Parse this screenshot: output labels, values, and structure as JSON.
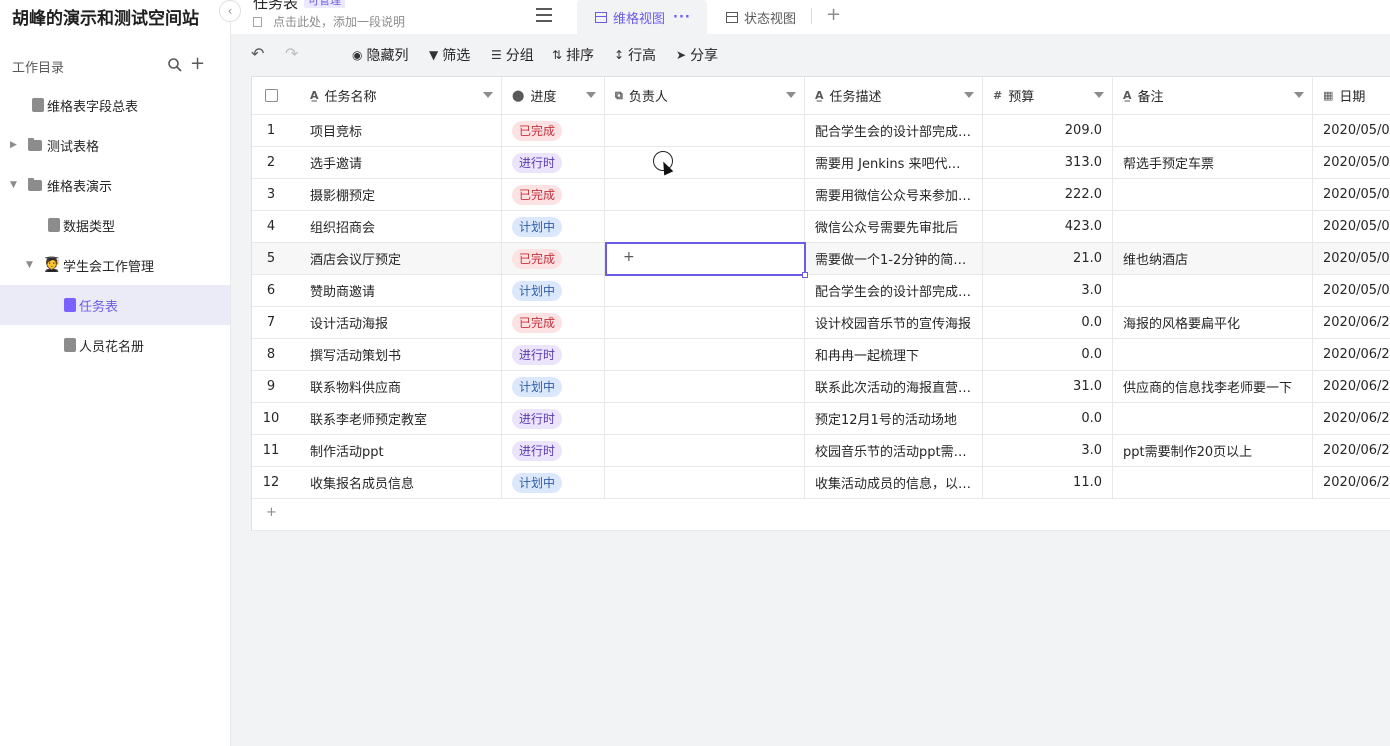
{
  "sidebar": {
    "space_title": "胡峰的演示和测试空间站",
    "directory_label": "工作目录",
    "items": [
      {
        "label": "维格表字段总表",
        "type": "doc",
        "level": 1,
        "active": false
      },
      {
        "label": "测试表格",
        "type": "folder",
        "level": 0,
        "expanded": false,
        "active": false
      },
      {
        "label": "维格表演示",
        "type": "folder",
        "level": 0,
        "expanded": true,
        "active": false
      },
      {
        "label": "数据类型",
        "type": "doc",
        "level": 2,
        "active": false
      },
      {
        "label": "学生会工作管理",
        "type": "emoji-folder",
        "emoji": "🧑‍🎓",
        "level": 1,
        "expanded": true,
        "active": false
      },
      {
        "label": "任务表",
        "type": "doc",
        "level": 3,
        "active": true
      },
      {
        "label": "人员花名册",
        "type": "doc",
        "level": 3,
        "active": false
      }
    ]
  },
  "header": {
    "table_title": "任务表",
    "permission_badge": "可管理",
    "description_placeholder": "点击此处，添加一段说明",
    "tabs": [
      {
        "label": "维格视图",
        "active": true,
        "more": "···"
      },
      {
        "label": "状态视图",
        "active": false
      }
    ],
    "add_view": "+"
  },
  "toolbar": {
    "undo": "↶",
    "redo": "↷",
    "hide_columns": "隐藏列",
    "filter": "筛选",
    "group": "分组",
    "sort": "排序",
    "row_height": "行高",
    "share": "分享"
  },
  "grid": {
    "columns": {
      "name": "任务名称",
      "progress": "进度",
      "owner": "负责人",
      "desc": "任务描述",
      "budget": "预算",
      "note": "备注",
      "date": "日期"
    },
    "rows": [
      {
        "idx": "1",
        "name": "项目竞标",
        "progress": "已完成",
        "status": "done",
        "desc": "配合学生会的设计部完成…",
        "budget": "209.0",
        "note": "",
        "date": "2020/05/0"
      },
      {
        "idx": "2",
        "name": "选手邀请",
        "progress": "进行时",
        "status": "doing",
        "desc": "需要用 Jenkins 来吧代码…",
        "budget": "313.0",
        "note": "帮选手预定车票",
        "date": "2020/05/0"
      },
      {
        "idx": "3",
        "name": "摄影棚预定",
        "progress": "已完成",
        "status": "done",
        "desc": "需要用微信公众号来参加…",
        "budget": "222.0",
        "note": "",
        "date": "2020/05/0"
      },
      {
        "idx": "4",
        "name": "组织招商会",
        "progress": "计划中",
        "status": "plan",
        "desc": "微信公众号需要先审批后",
        "budget": "423.0",
        "note": "",
        "date": "2020/05/0"
      },
      {
        "idx": "5",
        "name": "酒店会议厅预定",
        "progress": "已完成",
        "status": "done",
        "desc": "需要做一个1-2分钟的简…",
        "budget": "21.0",
        "note": "维也纳酒店",
        "date": "2020/05/0"
      },
      {
        "idx": "6",
        "name": "赞助商邀请",
        "progress": "计划中",
        "status": "plan",
        "desc": "配合学生会的设计部完成…",
        "budget": "3.0",
        "note": "",
        "date": "2020/05/0"
      },
      {
        "idx": "7",
        "name": "设计活动海报",
        "progress": "已完成",
        "status": "done",
        "desc": "设计校园音乐节的宣传海报",
        "budget": "0.0",
        "note": "海报的风格要扁平化",
        "date": "2020/06/2"
      },
      {
        "idx": "8",
        "name": "撰写活动策划书",
        "progress": "进行时",
        "status": "doing",
        "desc": "和冉冉一起梳理下",
        "budget": "0.0",
        "note": "",
        "date": "2020/06/2"
      },
      {
        "idx": "9",
        "name": "联系物料供应商",
        "progress": "计划中",
        "status": "plan",
        "desc": "联系此次活动的海报直营…",
        "budget": "31.0",
        "note": "供应商的信息找李老师要一下",
        "date": "2020/06/2"
      },
      {
        "idx": "10",
        "name": "联系李老师预定教室",
        "progress": "进行时",
        "status": "doing",
        "desc": "预定12月1号的活动场地",
        "budget": "0.0",
        "note": "",
        "date": "2020/06/2"
      },
      {
        "idx": "11",
        "name": "制作活动ppt",
        "progress": "进行时",
        "status": "doing",
        "desc": "校园音乐节的活动ppt需…",
        "budget": "3.0",
        "note": "ppt需要制作20页以上",
        "date": "2020/06/2"
      },
      {
        "idx": "12",
        "name": "收集报名成员信息",
        "progress": "计划中",
        "status": "plan",
        "desc": "收集活动成员的信息，以…",
        "budget": "11.0",
        "note": "",
        "date": "2020/06/2"
      }
    ],
    "add_row": "+",
    "selected_cell_plus": "+"
  },
  "colors": {
    "accent": "#6b5ce7",
    "done_bg": "#fde2e4",
    "doing_bg": "#ece4fb",
    "plan_bg": "#dbe8fb"
  }
}
